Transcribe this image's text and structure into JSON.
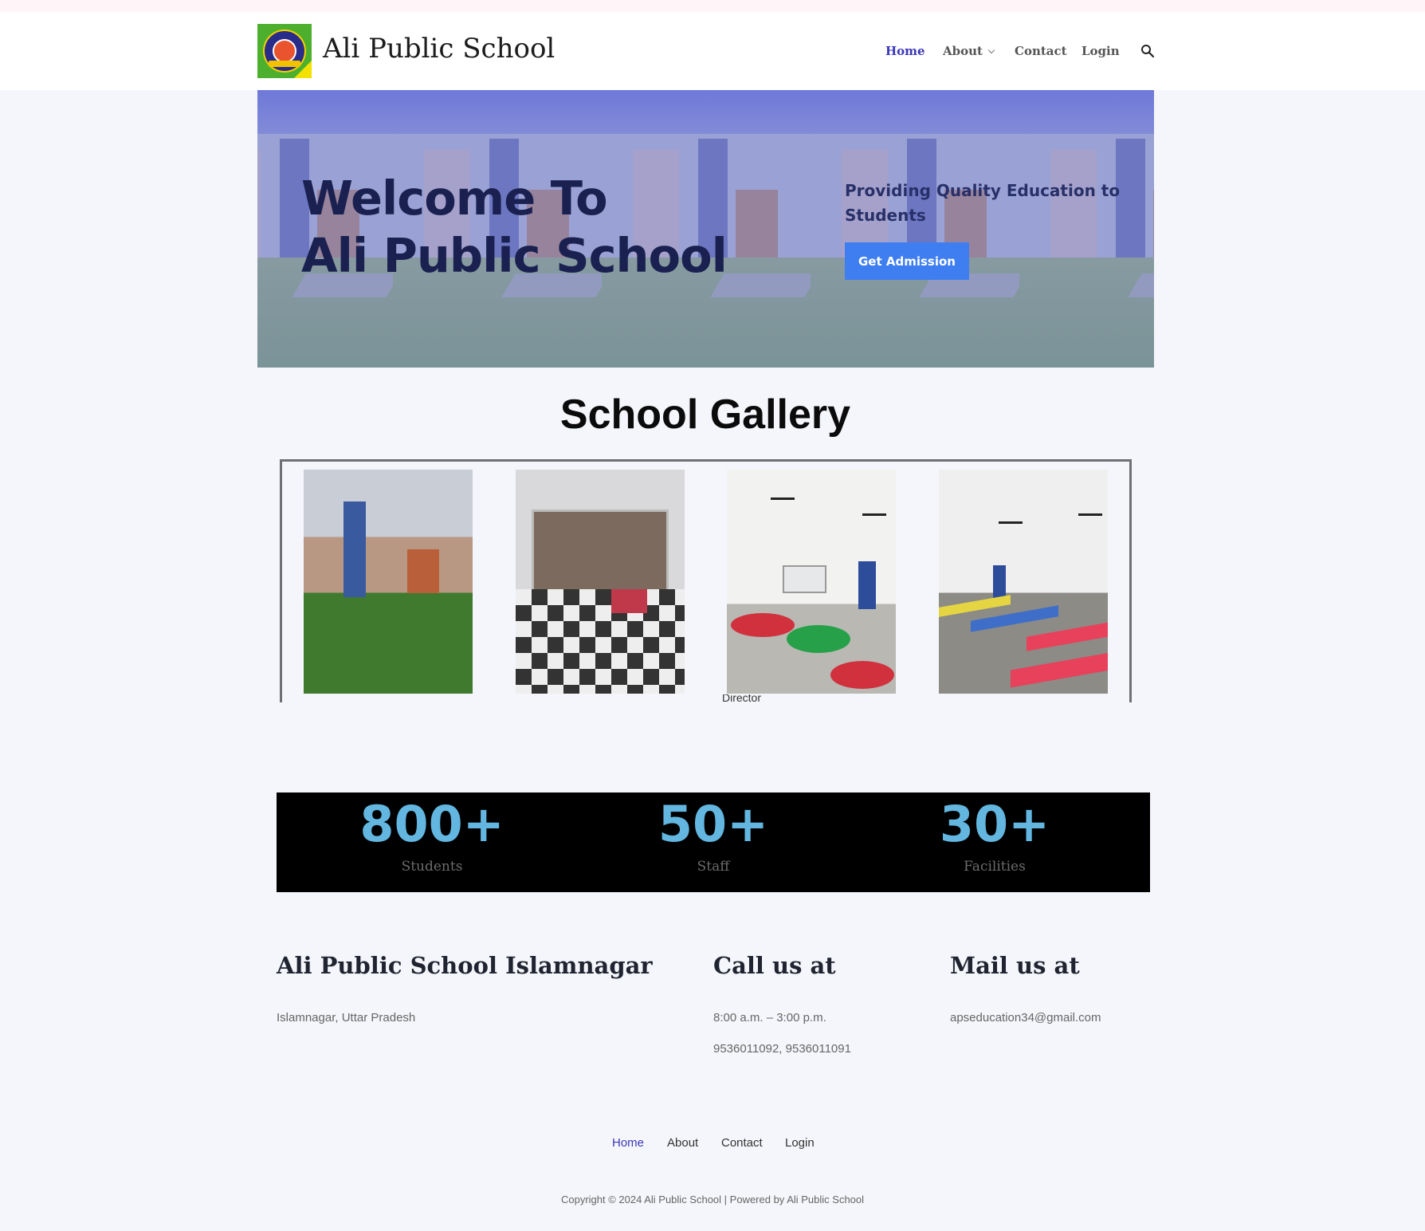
{
  "header": {
    "site_title": "Ali Public School",
    "logo_alt": "Ali Public School logo",
    "nav": [
      {
        "label": "Home",
        "active": true
      },
      {
        "label": "About",
        "active": false
      },
      {
        "label": "Contact",
        "active": false
      },
      {
        "label": "Login",
        "active": false
      }
    ]
  },
  "hero": {
    "heading_line1": "Welcome To",
    "heading_line2": "Ali Public School",
    "tagline": "Providing Quality Education to Students",
    "cta_label": "Get Admission"
  },
  "gallery": {
    "title": "School Gallery",
    "images": [
      "school-building-photo",
      "reception-lobby-photo",
      "classroom-round-tables-photo",
      "classroom-desks-photo"
    ],
    "partial_caption": "Director"
  },
  "stats": [
    {
      "value": "800+",
      "label": "Students"
    },
    {
      "value": "50+",
      "label": "Staff"
    },
    {
      "value": "30+",
      "label": "Facilities"
    }
  ],
  "footer": {
    "school": {
      "heading": "Ali Public School Islamnagar",
      "address": "Islamnagar, Uttar Pradesh"
    },
    "call": {
      "heading": "Call us at",
      "hours": "8:00 a.m. – 3:00 p.m.",
      "phones": "9536011092,  9536011091"
    },
    "mail": {
      "heading": "Mail us at",
      "email": "apseducation34@gmail.com"
    },
    "nav": [
      {
        "label": "Home",
        "active": true
      },
      {
        "label": "About",
        "active": false
      },
      {
        "label": "Contact",
        "active": false
      },
      {
        "label": "Login",
        "active": false
      }
    ],
    "copyright": "Copyright © 2024 Ali Public School | Powered by Ali Public School"
  },
  "colors": {
    "accent": "#3a36b8",
    "button": "#3f7ef0",
    "stat_number": "#62b6df",
    "stats_bg": "#000000",
    "page_bg": "#f5f6fb"
  }
}
